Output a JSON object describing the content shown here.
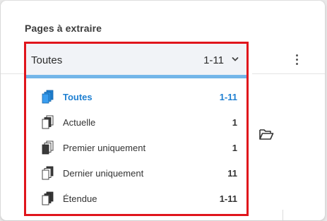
{
  "section": {
    "title": "Pages à extraire"
  },
  "select": {
    "label": "Toutes",
    "value": "1-11",
    "chevron_icon": "chevron-down-icon"
  },
  "colors": {
    "accent": "#1f80d2",
    "highlight_border": "#e0151c",
    "underline": "#72b5e8"
  },
  "menu": {
    "items": [
      {
        "label": "Toutes",
        "count": "1-11",
        "icon": "all-pages-icon",
        "selected": true
      },
      {
        "label": "Actuelle",
        "count": "1",
        "icon": "current-page-icon",
        "selected": false
      },
      {
        "label": "Premier uniquement",
        "count": "1",
        "icon": "first-page-icon",
        "selected": false
      },
      {
        "label": "Dernier uniquement",
        "count": "11",
        "icon": "last-page-icon",
        "selected": false
      },
      {
        "label": "Étendue",
        "count": "1-11",
        "icon": "page-range-icon",
        "selected": false
      }
    ]
  },
  "side": {
    "more_icon": "more-vertical-icon",
    "folder_icon": "folder-open-icon"
  }
}
